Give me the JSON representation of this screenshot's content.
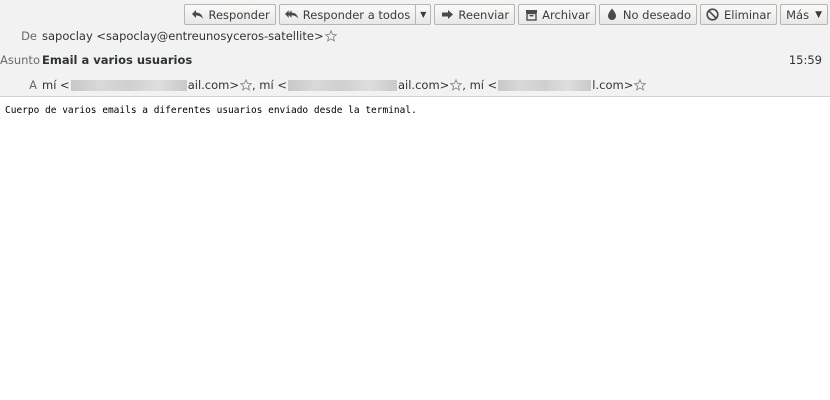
{
  "toolbar": {
    "reply": "Responder",
    "reply_all": "Responder a todos",
    "forward": "Reenviar",
    "archive": "Archivar",
    "junk": "No deseado",
    "delete": "Eliminar",
    "more": "Más"
  },
  "header": {
    "from_label": "De",
    "from_value": "sapoclay <sapoclay@entreunosyceros-satellite>",
    "subject_label": "Asunto",
    "subject_value": "Email a varios usuarios",
    "time": "15:59",
    "to_label": "A",
    "recipients": [
      {
        "prefix": "mí <",
        "suffix": "ail.com>"
      },
      {
        "prefix": ", mí <",
        "suffix": "ail.com>"
      },
      {
        "prefix": ", mí <",
        "suffix": "l.com>"
      }
    ]
  },
  "message": {
    "body": "Cuerpo de varios emails a diferentes usuarios enviado desde la terminal."
  },
  "icons": [
    "reply-icon",
    "reply-all-icon",
    "forward-icon",
    "archive-icon",
    "junk-icon",
    "delete-icon",
    "star-icon"
  ]
}
